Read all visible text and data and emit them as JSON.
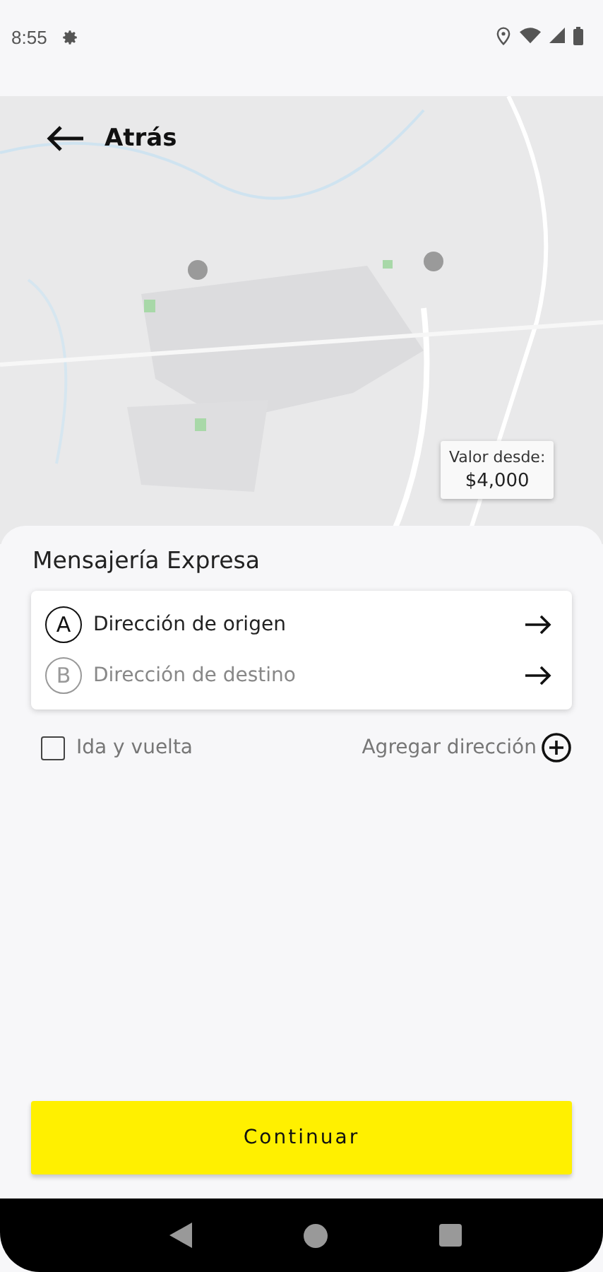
{
  "status_bar": {
    "time": "8:55"
  },
  "map": {
    "back_label": "Atrás",
    "price": {
      "label": "Valor desde:",
      "value": "$4,000"
    }
  },
  "sheet": {
    "title": "Mensajería Expresa",
    "addresses": [
      {
        "letter": "A",
        "label": "Dirección de origen",
        "selected": true
      },
      {
        "letter": "B",
        "label": "Dirección de destino",
        "selected": false
      }
    ],
    "round_trip": {
      "label": "Ida y vuelta",
      "checked": false
    },
    "add_address": "Agregar dirección",
    "continue": "Continuar"
  }
}
